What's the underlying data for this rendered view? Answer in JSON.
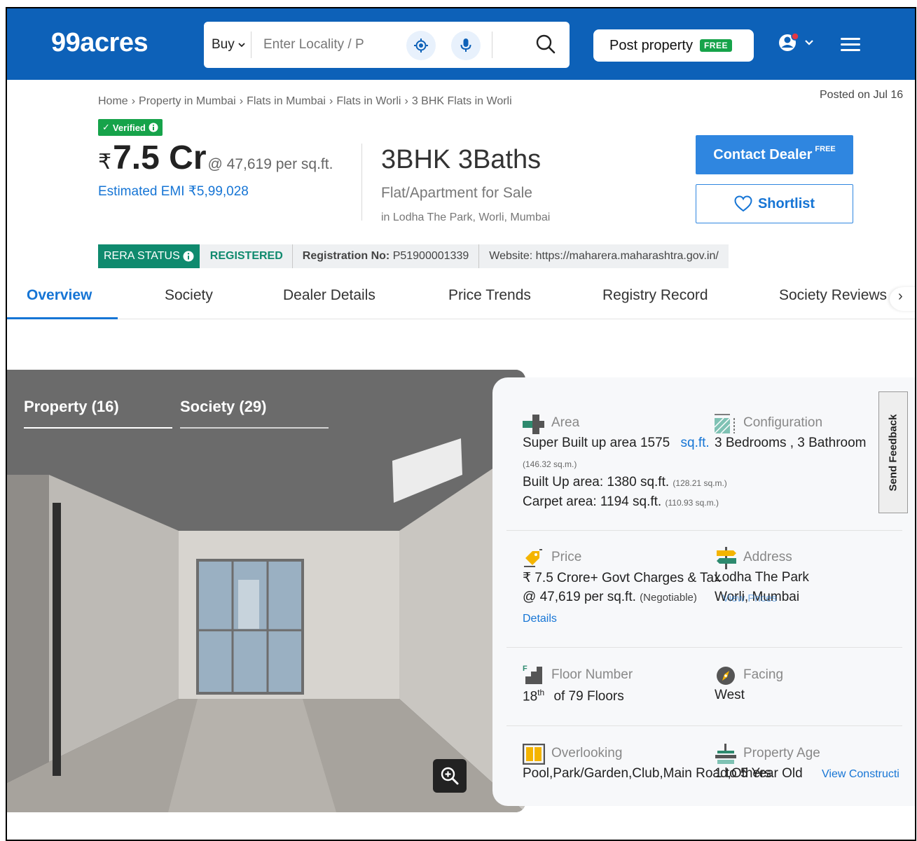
{
  "header": {
    "logo": "99acres",
    "buy_label": "Buy",
    "search_placeholder": "Enter Locality / P",
    "post_property_label": "Post property",
    "post_property_badge": "FREE"
  },
  "breadcrumb": {
    "items": [
      "Home",
      "Property in Mumbai",
      "Flats in Mumbai",
      "Flats in Worli",
      "3 BHK Flats in Worli"
    ]
  },
  "posted_on": "Posted on Jul 16",
  "listing": {
    "verified_label": "Verified",
    "currency": "₹",
    "price": "7.5 Cr",
    "price_per_sqft": "@ 47,619 per sq.ft.",
    "emi": "Estimated EMI ₹5,99,028",
    "title": "3BHK 3Baths",
    "type": "Flat/Apartment for Sale",
    "location": "in Lodha The Park, Worli, Mumbai"
  },
  "actions": {
    "contact_dealer": "Contact Dealer",
    "contact_badge": "FREE",
    "shortlist": "Shortlist"
  },
  "rera": {
    "status_label": "RERA STATUS",
    "status_value": "REGISTERED",
    "registration_label": "Registration No:",
    "registration_no": "P51900001339",
    "website": "Website: https://maharera.maharashtra.gov.in/"
  },
  "tabs": [
    "Overview",
    "Society",
    "Dealer Details",
    "Price Trends",
    "Registry Record",
    "Society Reviews"
  ],
  "gallery": {
    "property_tab": "Property (16)",
    "society_tab": "Society (29)"
  },
  "details": {
    "area_label": "Area",
    "super_built_up": "Super Built up area 1575",
    "super_unit": "sq.ft.",
    "super_sqm": "(146.32 sq.m.)",
    "built_up": "Built Up area: 1380 sq.ft.",
    "built_up_sqm": "(128.21 sq.m.)",
    "carpet": "Carpet area: 1194 sq.ft.",
    "carpet_sqm": "(110.93 sq.m.)",
    "configuration_label": "Configuration",
    "configuration_value": "3 Bedrooms , 3 Bathroom",
    "price_label": "Price",
    "price_value": "₹ 7.5 Crore+ Govt Charges & Tax",
    "price_per": "@ 47,619 per sq.ft.",
    "negotiable": "(Negotiable)",
    "price_details_link": "Details",
    "address_label": "Address",
    "address_line1": "Lodha The Park",
    "address_line2": "Worli, Mumbai",
    "view_prices": "View Prices",
    "floor_label": "Floor Number",
    "floor_num": "18",
    "floor_sup": "th",
    "floor_of": "of 79 Floors",
    "facing_label": "Facing",
    "facing_value": "West",
    "overlooking_label": "Overlooking",
    "overlooking_value": "Pool,Park/Garden,Club,Main Road,Others",
    "age_label": "Property Age",
    "age_value": "1 to 5 Year Old",
    "view_construction": "View Constructi"
  },
  "feedback_label": "Send Feedback"
}
